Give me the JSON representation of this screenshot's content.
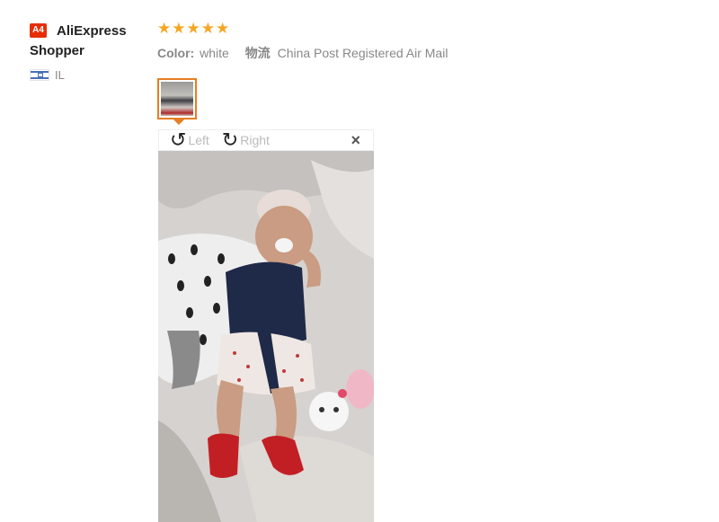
{
  "reviewer": {
    "avatar_text": "A4",
    "name": "AliExpress Shopper",
    "country_code": "IL",
    "flag_icon": "israel-flag-icon"
  },
  "review": {
    "rating": 5,
    "stars": [
      "★",
      "★",
      "★",
      "★",
      "★"
    ],
    "star_color": "#f5a623",
    "attributes": {
      "color_label": "Color:",
      "color_value": "white",
      "shipping_label": "物流",
      "shipping_value": "China Post Registered Air Mail"
    }
  },
  "viewer": {
    "rotate_left_label": "Left",
    "rotate_right_label": "Right",
    "rotate_left_icon": "↺",
    "rotate_right_icon": "↻",
    "close_icon": "×",
    "accent_color": "#e67e22"
  }
}
